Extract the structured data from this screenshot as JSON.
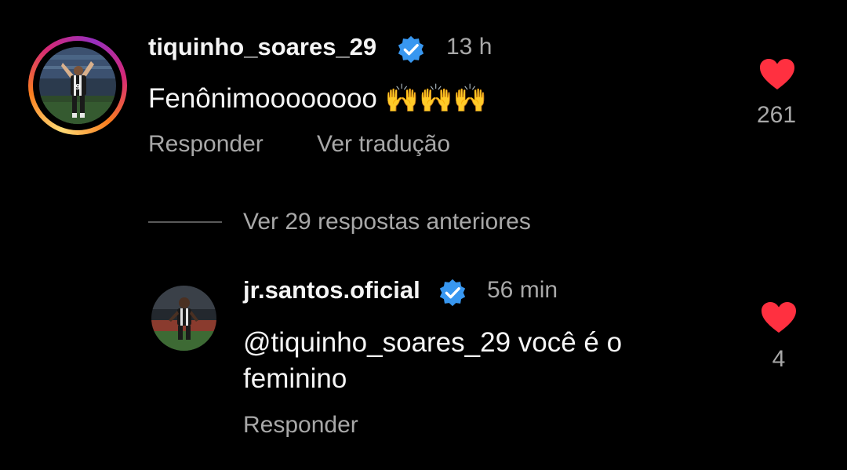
{
  "main_comment": {
    "username": "tiquinho_soares_29",
    "verified": true,
    "timestamp": "13 h",
    "text": "Fenônimoooooooo 🙌🙌🙌",
    "like_count": "261",
    "actions": {
      "reply": "Responder",
      "translate": "Ver tradução"
    }
  },
  "replies_toggle": {
    "label": "Ver 29 respostas anteriores"
  },
  "reply_comment": {
    "username": "jr.santos.oficial",
    "verified": true,
    "timestamp": "56 min",
    "text_line1": "@tiquinho_soares_29 você é o",
    "text_line2": "feminino",
    "like_count": "4",
    "actions": {
      "reply": "Responder"
    }
  },
  "colors": {
    "background": "#000000",
    "primary_text": "#f5f5f5",
    "secondary_text": "#a8a8a8",
    "heart": "#ff3040",
    "verified_badge": "#3897f0"
  },
  "icons": {
    "verified": "verified-badge-icon",
    "like": "heart-filled-icon"
  }
}
